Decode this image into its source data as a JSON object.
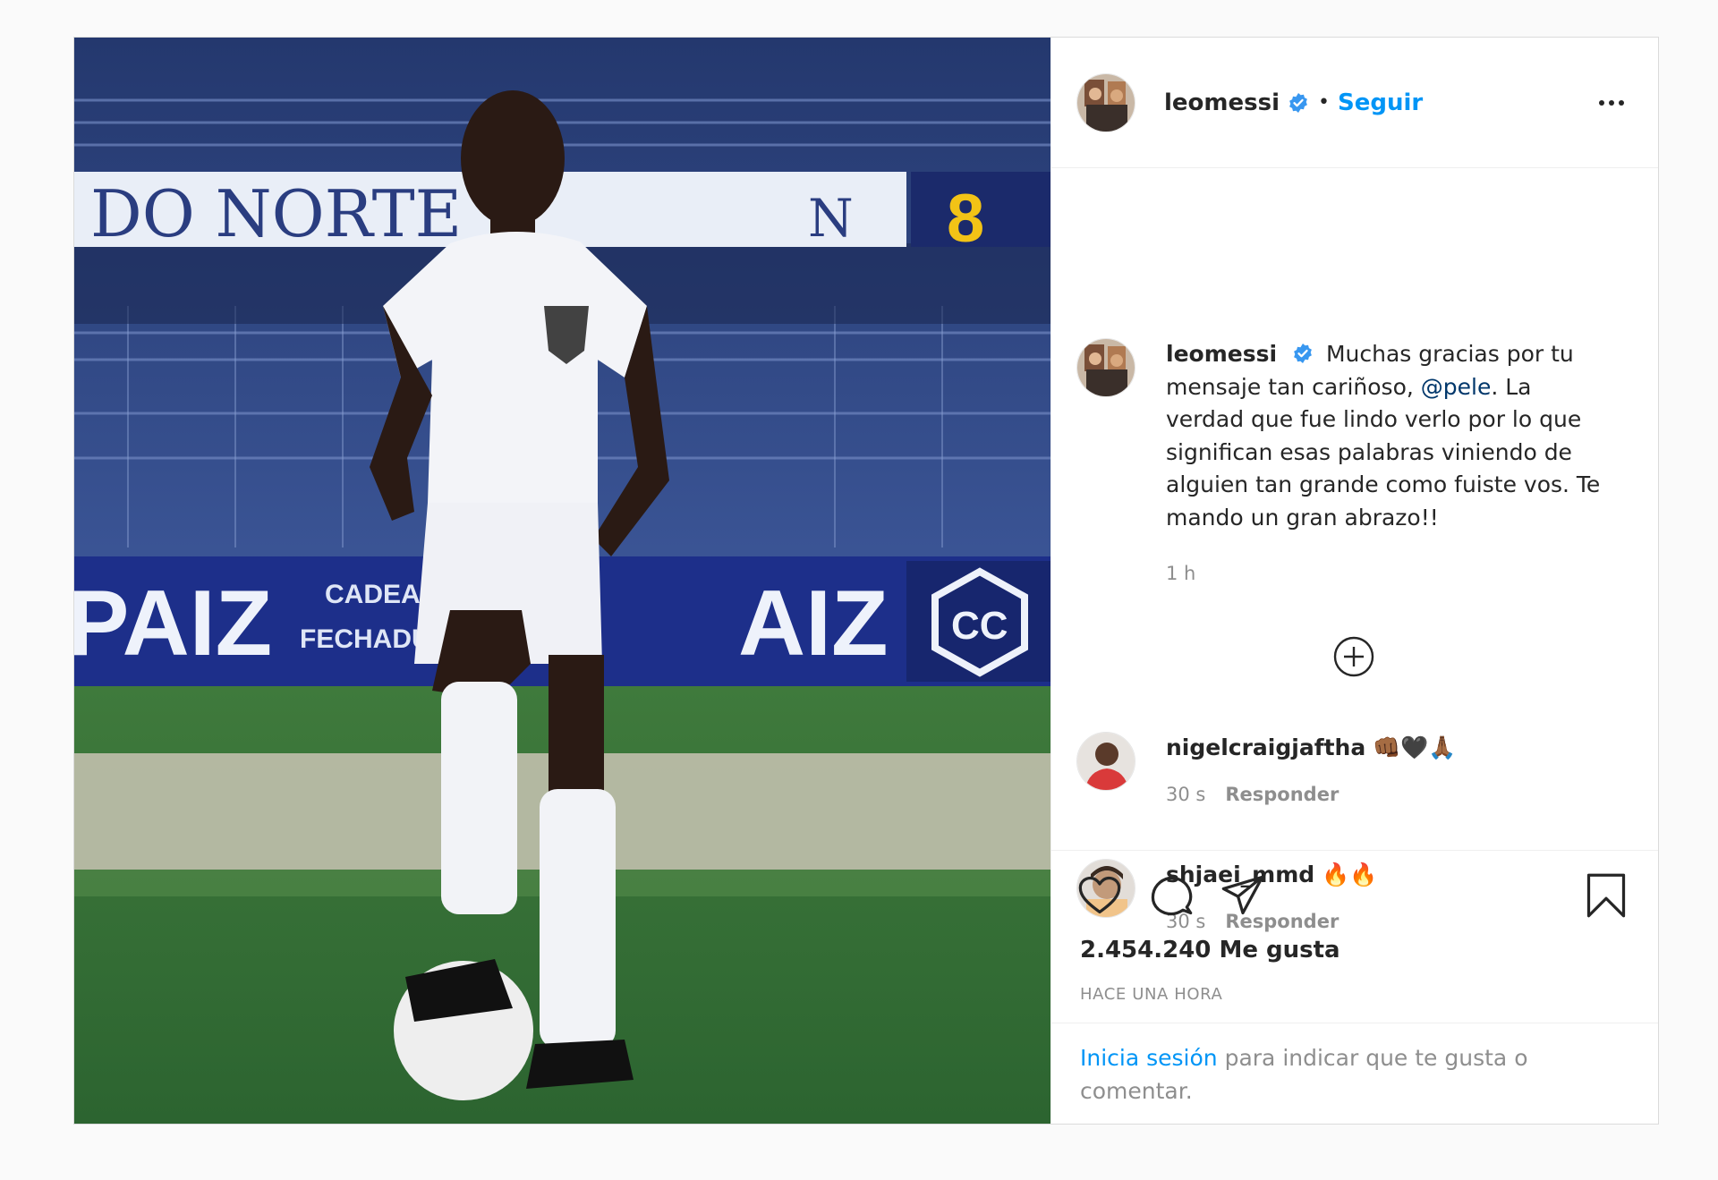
{
  "post": {
    "username": "leomessi",
    "verified": true,
    "separator": "•",
    "follow_label": "Seguir",
    "more_icon": "more-horizontal-icon",
    "photo": {
      "banner_left": "DO NORTE",
      "banner_letter": "N",
      "banner_number": "8",
      "ad_left": "PAIZ",
      "ad_small_top": "CADEADOS",
      "ad_small_bottom": "FECHADURA",
      "ad_right": "AIZ",
      "ad_logo": "CC"
    }
  },
  "caption": {
    "username": "leomessi",
    "text_before_mention": "Muchas gracias por tu mensaje tan cariñoso, ",
    "mention": "@pele",
    "text_after_mention": ". La verdad que fue lindo verlo por lo que significan esas palabras viniendo de alguien tan grande como fuiste vos. Te mando un gran abrazo!!",
    "time": "1 h"
  },
  "load_more_icon": "plus-circle-icon",
  "comments": [
    {
      "username": "nigelcraigjaftha",
      "text": "👊🏾🖤🙏🏾",
      "time": "30 s",
      "reply_label": "Responder"
    },
    {
      "username": "shjaei_mmd",
      "text": "🔥🔥",
      "time": "30 s",
      "reply_label": "Responder"
    }
  ],
  "actions": {
    "like_icon": "heart-icon",
    "comment_icon": "comment-icon",
    "share_icon": "share-icon",
    "save_icon": "bookmark-icon"
  },
  "likes": "2.454.240 Me gusta",
  "posted_ago": "HACE UNA HORA",
  "login_prompt": {
    "link": "Inicia sesión",
    "text": " para indicar que te gusta o comentar."
  },
  "colors": {
    "link_blue": "#0095f6",
    "mention_blue": "#00376b",
    "verified_blue": "#3897f0",
    "muted": "#8e8e8e"
  }
}
